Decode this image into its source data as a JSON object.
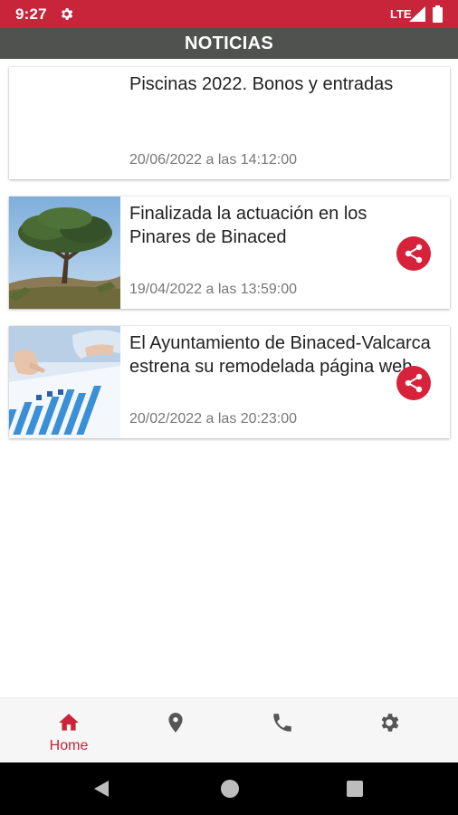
{
  "status_bar": {
    "time": "9:27",
    "network": "LTE",
    "icons": [
      "gear-icon",
      "signal-icon",
      "battery-icon"
    ]
  },
  "header": {
    "title": "NOTICIAS"
  },
  "news": [
    {
      "title": "Piscinas 2022. Bonos y entradas",
      "date": "20/06/2022 a las 14:12:00",
      "has_share": false,
      "image": "none"
    },
    {
      "title": "Finalizada la actuación en los Pinares de Binaced",
      "date": "19/04/2022 a las 13:59:00",
      "has_share": true,
      "image": "pine-tree-photo"
    },
    {
      "title": "El Ayuntamiento de Binaced-Valcarca estrena su remodelada página web",
      "date": "20/02/2022 a las 20:23:00",
      "has_share": true,
      "image": "business-chart-photo"
    }
  ],
  "bottom_nav": {
    "items": [
      {
        "label": "Home",
        "icon": "home-icon",
        "active": true
      },
      {
        "label": "",
        "icon": "location-pin-icon",
        "active": false
      },
      {
        "label": "",
        "icon": "phone-icon",
        "active": false
      },
      {
        "label": "",
        "icon": "settings-gear-icon",
        "active": false
      }
    ]
  },
  "colors": {
    "primary": "#c8243a",
    "header_bg": "#505250",
    "share": "#d6223a",
    "nav_inactive": "#555555",
    "date_text": "#777777"
  }
}
